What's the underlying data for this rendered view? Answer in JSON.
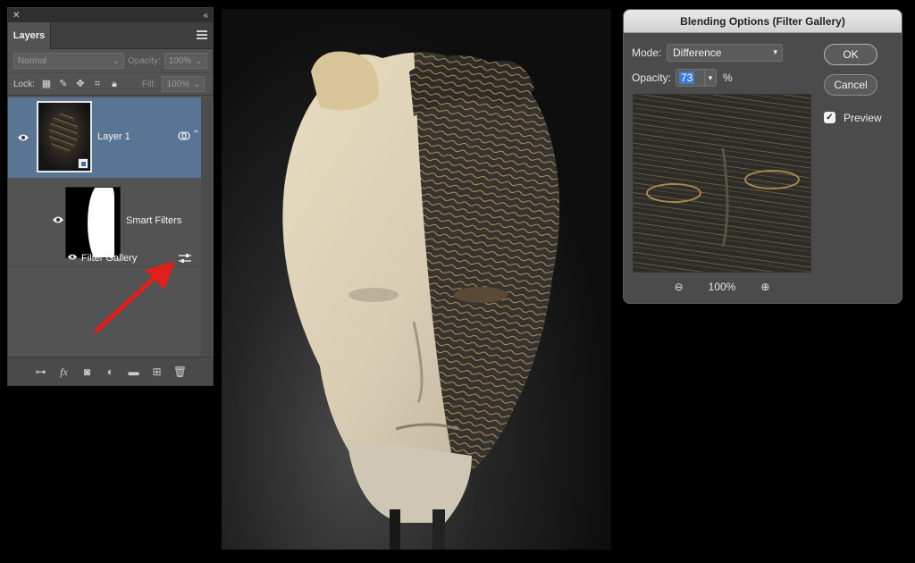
{
  "layers_panel": {
    "close_glyph": "✕",
    "collapse_glyph": "«",
    "tab_label": "Layers",
    "blend_mode": "Normal",
    "opacity_label": "Opacity:",
    "opacity_value": "100%",
    "lock_label": "Lock:",
    "fill_label": "Fill:",
    "fill_value": "100%",
    "layer_name": "Layer 1",
    "smart_filters_label": "Smart Filters",
    "filter_name": "Filter Gallery"
  },
  "dialog": {
    "title": "Blending Options (Filter Gallery)",
    "mode_label": "Mode:",
    "mode_value": "Difference",
    "opacity_label": "Opacity:",
    "opacity_value": "73",
    "opacity_unit": "%",
    "ok_label": "OK",
    "cancel_label": "Cancel",
    "preview_label": "Preview",
    "preview_checked": true,
    "zoom_value": "100%"
  },
  "colors": {
    "panel_bg": "#535353",
    "selected_layer": "#5a7593",
    "arrow": "#e0201c",
    "highlight": "#3d7bd6"
  }
}
